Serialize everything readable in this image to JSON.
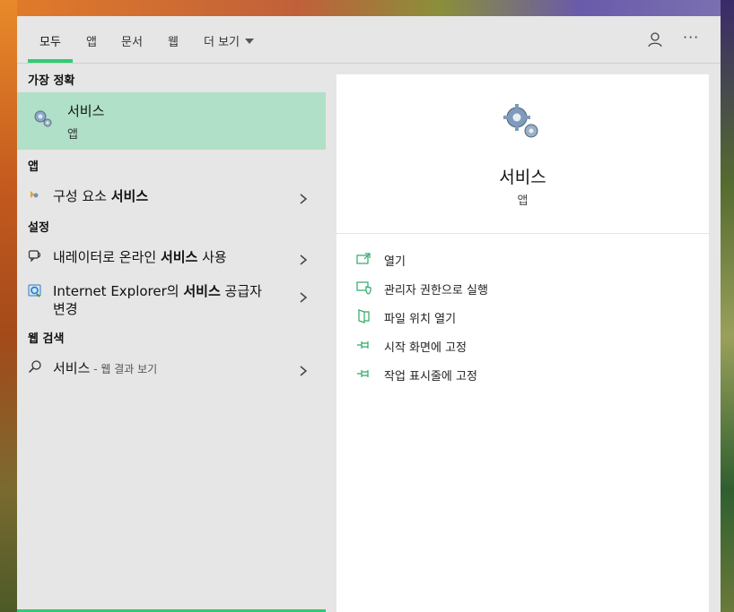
{
  "tabs": [
    {
      "label": "모두",
      "active": true
    },
    {
      "label": "앱"
    },
    {
      "label": "문서"
    },
    {
      "label": "웹"
    },
    {
      "label": "더 보기"
    }
  ],
  "colors": {
    "accent": "#2ecc71",
    "selected_bg": "#b0e0c7",
    "panel_bg": "#e6e6e6"
  },
  "left": {
    "best_match_header": "가장 정확",
    "best_match": {
      "title": "서비스",
      "subtitle": "앱",
      "icon": "gears-icon"
    },
    "apps_header": "앱",
    "apps": [
      {
        "prefix": "구성 요소 ",
        "bold": "서비스",
        "icon": "component-services-icon"
      }
    ],
    "settings_header": "설정",
    "settings": [
      {
        "prefix": "내레이터로 온라인 ",
        "bold": "서비스",
        "suffix": " 사용",
        "icon": "narrator-icon"
      },
      {
        "prefix": "Internet Explorer의 ",
        "bold": "서비스",
        "suffix": " 공급자",
        "line2": "변경",
        "icon": "internet-explorer-icon"
      }
    ],
    "web_header": "웹 검색",
    "web": {
      "term": "서비스",
      "hint": " - 웹 결과 보기",
      "icon": "search-icon"
    }
  },
  "preview": {
    "title": "서비스",
    "subtitle": "앱",
    "actions": [
      {
        "label": "열기",
        "icon": "open-icon"
      },
      {
        "label": "관리자 권한으로 실행",
        "icon": "run-as-admin-icon"
      },
      {
        "label": "파일 위치 열기",
        "icon": "file-location-icon"
      },
      {
        "label": "시작 화면에 고정",
        "icon": "pin-icon"
      },
      {
        "label": "작업 표시줄에 고정",
        "icon": "pin-icon"
      }
    ]
  }
}
